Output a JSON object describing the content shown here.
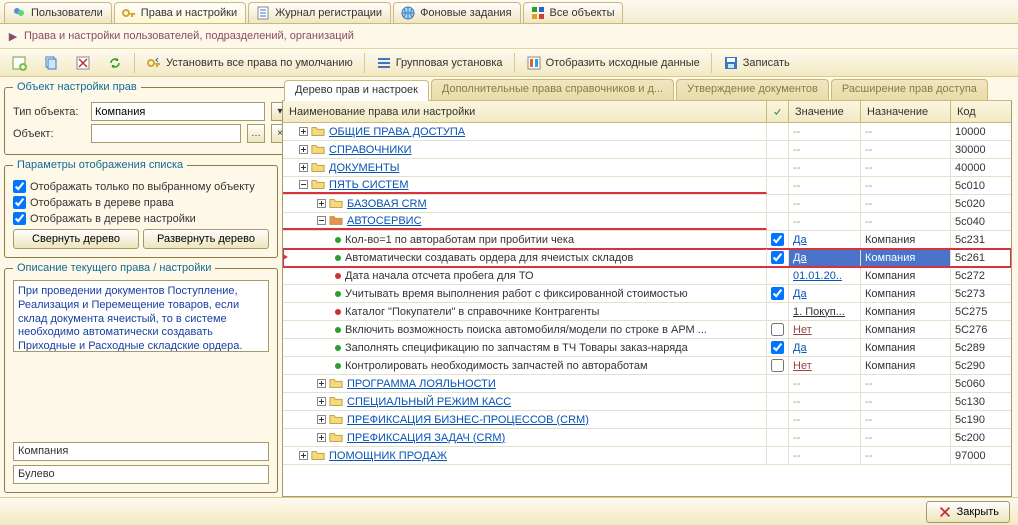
{
  "topTabs": [
    {
      "id": "users",
      "label": "Пользователи"
    },
    {
      "id": "rights",
      "label": "Права и настройки"
    },
    {
      "id": "journal",
      "label": "Журнал регистрации"
    },
    {
      "id": "bg",
      "label": "Фоновые задания"
    },
    {
      "id": "all",
      "label": "Все объекты"
    }
  ],
  "subtitle": "Права и настройки пользователей, подразделений, организаций",
  "toolbar": {
    "set_default": "Установить все права по умолчанию",
    "group_set": "Групповая установка",
    "show_source": "Отобразить исходные данные",
    "save": "Записать"
  },
  "left": {
    "object_group": "Объект настройки прав",
    "type_label": "Тип объекта:",
    "type_value": "Компания",
    "object_label": "Объект:",
    "object_value": "",
    "display_group": "Параметры отображения списка",
    "chk1": "Отображать только по выбранному объекту",
    "chk2": "Отображать в дереве права",
    "chk3": "Отображать в дереве настройки",
    "btn_collapse": "Свернуть дерево",
    "btn_expand": "Развернуть дерево",
    "desc_group": "Описание текущего права / настройки",
    "desc_text": "При проведении документов Поступление, Реализация и Перемещение товаров, если склад документа ячеистый, то в системе необходимо автоматически создавать Приходные и Расходные складские ордера.",
    "field1": "Компания",
    "field2": "Булево"
  },
  "innerTabs": [
    {
      "id": "tree",
      "label": "Дерево прав и настроек"
    },
    {
      "id": "extra",
      "label": "Дополнительные права справочников и д..."
    },
    {
      "id": "approve",
      "label": "Утверждение документов"
    },
    {
      "id": "ext",
      "label": "Расширение прав доступа"
    }
  ],
  "grid": {
    "head": {
      "name": "Наименование права или настройки",
      "val": "Значение",
      "assign": "Назначение",
      "code": "Код"
    },
    "rows": [
      {
        "indent": 0,
        "type": "folder",
        "exp": "plus",
        "label": "ОБЩИЕ ПРАВА ДОСТУПА",
        "chk": null,
        "val": "--",
        "assign": "--",
        "code": "10000"
      },
      {
        "indent": 0,
        "type": "folder",
        "exp": "plus",
        "label": "СПРАВОЧНИКИ",
        "chk": null,
        "val": "--",
        "assign": "--",
        "code": "30000"
      },
      {
        "indent": 0,
        "type": "folder",
        "exp": "plus",
        "label": "ДОКУМЕНТЫ",
        "chk": null,
        "val": "--",
        "assign": "--",
        "code": "40000"
      },
      {
        "indent": 0,
        "type": "folder",
        "exp": "minus",
        "label": "ПЯТЬ СИСТЕМ",
        "chk": null,
        "val": "--",
        "assign": "--",
        "code": "5с010",
        "underline": true
      },
      {
        "indent": 1,
        "type": "folder",
        "exp": "plus",
        "label": "БАЗОВАЯ CRM",
        "chk": null,
        "val": "--",
        "assign": "--",
        "code": "5с020"
      },
      {
        "indent": 1,
        "type": "folder",
        "exp": "minus",
        "label": "АВТОСЕРВИС",
        "chk": null,
        "val": "--",
        "assign": "--",
        "code": "5с040",
        "underline": true,
        "red_folder": true
      },
      {
        "indent": 2,
        "type": "item",
        "bullet": "green",
        "label": "Кол-во=1 по авторaботам при пробитии чека",
        "chk": true,
        "val": "Да",
        "val_kind": "yes",
        "assign": "Компания",
        "code": "5с231"
      },
      {
        "indent": 2,
        "type": "item",
        "bullet": "green",
        "label": "Автоматически создавать ордера для ячеистых складов",
        "chk": true,
        "val": "Да",
        "val_kind": "yes",
        "assign": "Компания",
        "code": "5с261",
        "highlight": true,
        "arrow": true
      },
      {
        "indent": 2,
        "type": "item",
        "bullet": "red",
        "label": "Дата начала отсчета пробега для ТО",
        "chk": null,
        "val": "01.01.20..",
        "val_kind": "date",
        "assign": "Компания",
        "code": "5с272"
      },
      {
        "indent": 2,
        "type": "item",
        "bullet": "green",
        "label": "Учитывать время выполнения работ с фиксированной стоимостью",
        "chk": true,
        "val": "Да",
        "val_kind": "yes",
        "assign": "Компания",
        "code": "5с273"
      },
      {
        "indent": 2,
        "type": "item",
        "bullet": "red",
        "label": "Каталог \"Покупатели\" в справочнике Контрагенты",
        "chk": null,
        "val": "1. Покуп...",
        "val_kind": "text",
        "assign": "Компания",
        "code": "5С275"
      },
      {
        "indent": 2,
        "type": "item",
        "bullet": "green",
        "label": "Включить возможность поиска автомобиля/модели по строке в АРМ ...",
        "chk": false,
        "val": "Нет",
        "val_kind": "no",
        "assign": "Компания",
        "code": "5С276"
      },
      {
        "indent": 2,
        "type": "item",
        "bullet": "green",
        "label": "Заполнять спецификацию по запчастям в ТЧ Товары заказ-наряда",
        "chk": true,
        "val": "Да",
        "val_kind": "yes",
        "assign": "Компания",
        "code": "5с289"
      },
      {
        "indent": 2,
        "type": "item",
        "bullet": "green",
        "label": "Контролировать необходимость запчастей по автоработам",
        "chk": false,
        "val": "Нет",
        "val_kind": "no",
        "assign": "Компания",
        "code": "5с290"
      },
      {
        "indent": 1,
        "type": "folder",
        "exp": "plus",
        "label": "ПРОГРАММА ЛОЯЛЬНОСТИ",
        "chk": null,
        "val": "--",
        "assign": "--",
        "code": "5с060"
      },
      {
        "indent": 1,
        "type": "folder",
        "exp": "plus",
        "label": "СПЕЦИАЛЬНЫЙ РЕЖИМ КАСС",
        "chk": null,
        "val": "--",
        "assign": "--",
        "code": "5с130"
      },
      {
        "indent": 1,
        "type": "folder",
        "exp": "plus",
        "label": "ПРЕФИКСАЦИЯ БИЗНЕС-ПРОЦЕССОВ (CRM)",
        "chk": null,
        "val": "--",
        "assign": "--",
        "code": "5с190"
      },
      {
        "indent": 1,
        "type": "folder",
        "exp": "plus",
        "label": "ПРЕФИКСАЦИЯ ЗАДАЧ (CRM)",
        "chk": null,
        "val": "--",
        "assign": "--",
        "code": "5с200"
      },
      {
        "indent": 0,
        "type": "folder",
        "exp": "plus",
        "label": "ПОМОЩНИК ПРОДАЖ",
        "chk": null,
        "val": "--",
        "assign": "--",
        "code": "97000"
      }
    ]
  },
  "footer": {
    "close": "Закрыть"
  }
}
